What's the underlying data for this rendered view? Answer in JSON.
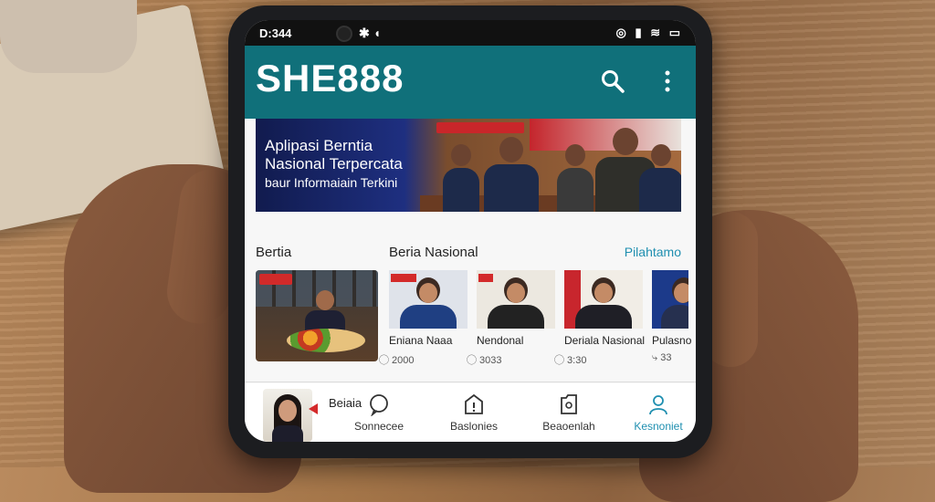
{
  "status_bar": {
    "time": "D:344",
    "icons_left": "✱ ◖",
    "icons_right": "◎ ▮ ≋ ▭"
  },
  "app": {
    "title": "SHE888",
    "search_icon": "search-icon",
    "more_icon": "more-vertical-icon",
    "brand_color": "#10707a"
  },
  "banner": {
    "line1": "Aplipasi Berntia",
    "line2": "Nasional Terpercata",
    "line3": "baur Informaiain Terkini"
  },
  "sections": {
    "left_title": "Bertia",
    "center_title": "Beria Nasional",
    "more_link": "Pilahtamo",
    "accent_color": "#1f8fb0"
  },
  "news": [
    {
      "title": "Eniana Naaa",
      "meta": "⃝ 2000"
    },
    {
      "title": "Nendonal",
      "meta": "⃝ 3033"
    },
    {
      "title": "Deriala Nasional",
      "meta": "⃝ 3:30"
    },
    {
      "title": "Pulasno",
      "meta": "⤷ 33"
    }
  ],
  "bottom_nav": {
    "berita_label": "Beiaia",
    "items": [
      {
        "label": "Sonnecee",
        "icon": "chat-bubble-icon"
      },
      {
        "label": "Baslonies",
        "icon": "notice-icon"
      },
      {
        "label": "Beaoenlah",
        "icon": "bookmark-icon"
      },
      {
        "label": "Kesnoniet",
        "icon": "profile-icon"
      }
    ]
  }
}
